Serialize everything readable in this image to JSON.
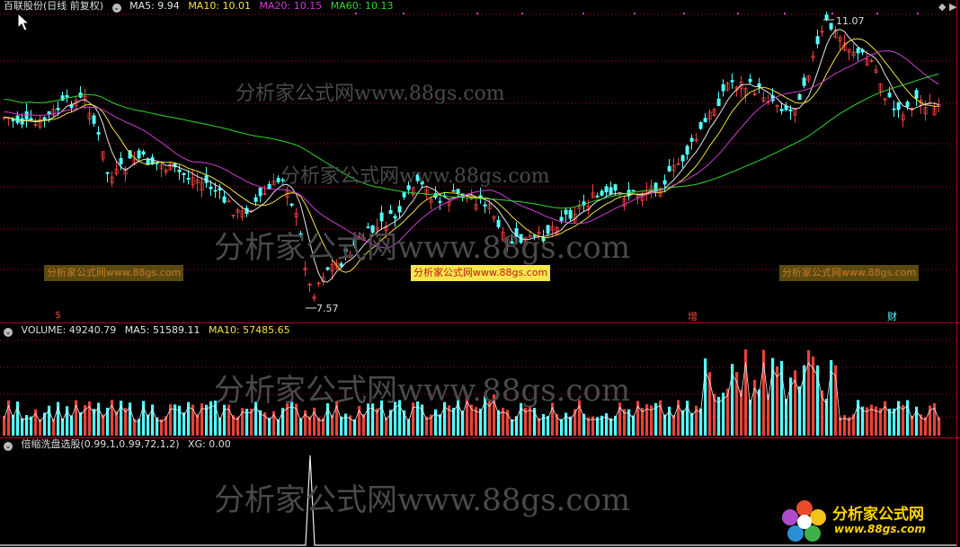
{
  "price_panel": {
    "title": "百联股份(日线 前复权)",
    "ma5": "MA5: 9.94",
    "ma10": "MA10: 10.01",
    "ma20": "MA20: 10.15",
    "ma60": "MA60: 10.13",
    "high_label": "11.07",
    "low_label": "7.57",
    "marker_s": "$",
    "marker_zeng": "增",
    "marker_cai": "财",
    "tag_left": "分析家公式网www.88gs.com",
    "tag_mid": "分析家公式网www.88gs.com",
    "tag_right": "分析家公式网www.88gs.com",
    "nav_arrows": "◆ ▶"
  },
  "volume_panel": {
    "volume": "VOLUME: 49240.79",
    "ma5": "MA5: 51589.11",
    "ma10": "MA10: 57485.65"
  },
  "indicator_panel": {
    "formula": "倍缩洗盘选股(0.99,1,0.99,72,1,2)",
    "xg": "XG: 0.00"
  },
  "watermarks": {
    "small": "分析家公式网www.88gs.com",
    "big": "分析家公式网www.88gs.com"
  },
  "logo": {
    "title": "分析家公式网",
    "url": "www.88gs.com"
  },
  "colors": {
    "up": "#e8433a",
    "down": "#54ffff",
    "ma5": "#e6e6e6",
    "ma10": "#f4e33a",
    "ma20": "#d43bd6",
    "ma60": "#2ed92e",
    "grid": "#b0002a"
  }
}
